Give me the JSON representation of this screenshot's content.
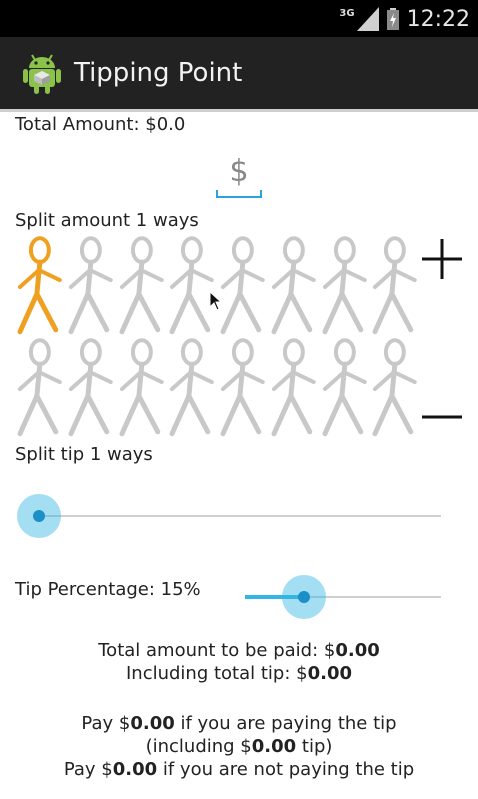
{
  "status_bar": {
    "network_label": "3G",
    "time": "12:22",
    "icons": [
      "signal-icon",
      "battery-icon"
    ]
  },
  "action_bar": {
    "app_icon": "android-icon",
    "title": "Tipping Point"
  },
  "total_amount": {
    "label": "Total Amount: $0.0"
  },
  "amount_input": {
    "placeholder": "$",
    "value": ""
  },
  "split_amount": {
    "label": "Split amount 1 ways",
    "people_total": 16,
    "people_selected": 1,
    "selected_color": "#f0a020",
    "unselected_color": "#c8c8c8",
    "plus_icon": "plus-icon",
    "minus_icon": "minus-icon"
  },
  "split_tip": {
    "label": "Split tip 1 ways",
    "slider_fraction": 0.0
  },
  "tip_percentage": {
    "label": "Tip Percentage: 15%",
    "slider_fraction": 0.3
  },
  "summary": {
    "total_prefix": "Total amount to be paid: $",
    "total_value": "0.00",
    "tip_prefix": "Including total tip: $",
    "tip_value": "0.00",
    "pay_prefix": "Pay $",
    "pay_tip_value": "0.00",
    "pay_tip_suffix": " if you are paying the tip",
    "including_prefix": "(including $",
    "including_value": "0.00",
    "including_suffix": " tip)",
    "pay_no_tip_value": "0.00",
    "pay_no_tip_suffix": " if you are not paying the tip"
  },
  "colors": {
    "accent": "#33b5e5",
    "action_bar": "#222222"
  }
}
